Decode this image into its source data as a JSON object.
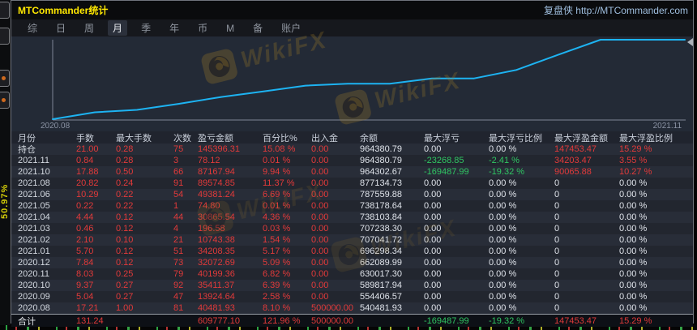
{
  "window": {
    "title": "MTCommander统计",
    "brand_link": "复盘侠 http://MTCommander.com"
  },
  "menu": {
    "items": [
      {
        "id": "zonghe",
        "label": "综",
        "active": false
      },
      {
        "id": "ri",
        "label": "日",
        "active": false
      },
      {
        "id": "zhou",
        "label": "周",
        "active": false
      },
      {
        "id": "yue",
        "label": "月",
        "active": true
      },
      {
        "id": "ji",
        "label": "季",
        "active": false
      },
      {
        "id": "nian",
        "label": "年",
        "active": false
      },
      {
        "id": "bi",
        "label": "币",
        "active": false
      },
      {
        "id": "m",
        "label": "M",
        "active": false
      },
      {
        "id": "bei",
        "label": "备",
        "active": false
      },
      {
        "id": "zhanghu",
        "label": "账户",
        "active": false
      }
    ]
  },
  "side_strip": {
    "vertical_text": "50.97%"
  },
  "chart": {
    "x_start_label": "2020.08",
    "x_end_label": "2021.11",
    "watermark_text": "WikiFX",
    "line_color": "#1db3f2"
  },
  "chart_data": {
    "type": "line",
    "title": "",
    "xlabel": "",
    "ylabel": "",
    "x_tick_labels": [
      "2020.08",
      "2021.11"
    ],
    "series": [
      {
        "name": "余额",
        "values": [
          500000,
          540481.93,
          554406.57,
          589817.94,
          630017.3,
          662089.99,
          696298.34,
          707041.72,
          707238.3,
          738103.84,
          738178.64,
          787559.88,
          877134.73,
          964302.67,
          964380.79,
          964380.79
        ]
      }
    ],
    "ylim": [
      500000,
      964380.79
    ],
    "grid": false,
    "legend": "none"
  },
  "colors": {
    "red": "#e23a3a",
    "green": "#30c663",
    "white": "#dfe3ea",
    "month": "#d5dae2",
    "header": "#c9cfda",
    "total_label": "#e8ebf0",
    "accent_line": "#1db3f2",
    "title_yellow": "#ffe800"
  },
  "table": {
    "headers": [
      "月份",
      "手数",
      "最大手数",
      "次数",
      "盈亏金额",
      "百分比%",
      "出入金",
      "余额",
      "最大浮亏",
      "最大浮亏比例",
      "最大浮盈金额",
      "最大浮盈比例"
    ],
    "rows": [
      {
        "month": "持仓",
        "values": [
          "21.00",
          "0.28",
          "75",
          "145396.31",
          "15.08 %",
          "0.00",
          "964380.79",
          "0.00",
          "0.00 %",
          "147453.47",
          "15.29 %"
        ],
        "colors": [
          "r",
          "r",
          "r",
          "r",
          "r",
          "r",
          "w",
          "w",
          "w",
          "r",
          "r"
        ]
      },
      {
        "month": "2021.11",
        "values": [
          "0.84",
          "0.28",
          "3",
          "78.12",
          "0.01 %",
          "0.00",
          "964380.79",
          "-23268.85",
          "-2.41 %",
          "34203.47",
          "3.55 %"
        ],
        "colors": [
          "r",
          "r",
          "r",
          "r",
          "r",
          "r",
          "w",
          "g",
          "g",
          "r",
          "r"
        ]
      },
      {
        "month": "2021.10",
        "values": [
          "17.88",
          "0.50",
          "66",
          "87167.94",
          "9.94 %",
          "0.00",
          "964302.67",
          "-169487.99",
          "-19.32 %",
          "90065.88",
          "10.27 %"
        ],
        "colors": [
          "r",
          "r",
          "r",
          "r",
          "r",
          "r",
          "w",
          "g",
          "g",
          "r",
          "r"
        ]
      },
      {
        "month": "2021.08",
        "values": [
          "20.82",
          "0.24",
          "91",
          "89574.85",
          "11.37 %",
          "0.00",
          "877134.73",
          "0.00",
          "0.00 %",
          "0",
          "0.00 %"
        ],
        "colors": [
          "r",
          "r",
          "r",
          "r",
          "r",
          "r",
          "w",
          "w",
          "w",
          "w",
          "w"
        ]
      },
      {
        "month": "2021.06",
        "values": [
          "10.29",
          "0.22",
          "54",
          "49381.24",
          "6.69 %",
          "0.00",
          "787559.88",
          "0.00",
          "0.00 %",
          "0",
          "0.00 %"
        ],
        "colors": [
          "r",
          "r",
          "r",
          "r",
          "r",
          "r",
          "w",
          "w",
          "w",
          "w",
          "w"
        ]
      },
      {
        "month": "2021.05",
        "values": [
          "0.22",
          "0.22",
          "1",
          "74.80",
          "0.01 %",
          "0.00",
          "738178.64",
          "0.00",
          "0.00 %",
          "0",
          "0.00 %"
        ],
        "colors": [
          "r",
          "r",
          "r",
          "r",
          "r",
          "r",
          "w",
          "w",
          "w",
          "w",
          "w"
        ]
      },
      {
        "month": "2021.04",
        "values": [
          "4.44",
          "0.12",
          "44",
          "30865.54",
          "4.36 %",
          "0.00",
          "738103.84",
          "0.00",
          "0.00 %",
          "0",
          "0.00 %"
        ],
        "colors": [
          "r",
          "r",
          "r",
          "r",
          "r",
          "r",
          "w",
          "w",
          "w",
          "w",
          "w"
        ]
      },
      {
        "month": "2021.03",
        "values": [
          "0.46",
          "0.12",
          "4",
          "196.58",
          "0.03 %",
          "0.00",
          "707238.30",
          "0.00",
          "0.00 %",
          "0",
          "0.00 %"
        ],
        "colors": [
          "r",
          "r",
          "r",
          "r",
          "r",
          "r",
          "w",
          "w",
          "w",
          "w",
          "w"
        ]
      },
      {
        "month": "2021.02",
        "values": [
          "2.10",
          "0.10",
          "21",
          "10743.38",
          "1.54 %",
          "0.00",
          "707041.72",
          "0.00",
          "0.00 %",
          "0",
          "0.00 %"
        ],
        "colors": [
          "r",
          "r",
          "r",
          "r",
          "r",
          "r",
          "w",
          "w",
          "w",
          "w",
          "w"
        ]
      },
      {
        "month": "2021.01",
        "values": [
          "5.70",
          "0.12",
          "51",
          "34208.35",
          "5.17 %",
          "0.00",
          "696298.34",
          "0.00",
          "0.00 %",
          "0",
          "0.00 %"
        ],
        "colors": [
          "r",
          "r",
          "r",
          "r",
          "r",
          "r",
          "w",
          "w",
          "w",
          "w",
          "w"
        ]
      },
      {
        "month": "2020.12",
        "values": [
          "7.84",
          "0.12",
          "73",
          "32072.69",
          "5.09 %",
          "0.00",
          "662089.99",
          "0.00",
          "0.00 %",
          "0",
          "0.00 %"
        ],
        "colors": [
          "r",
          "r",
          "r",
          "r",
          "r",
          "r",
          "w",
          "w",
          "w",
          "w",
          "w"
        ]
      },
      {
        "month": "2020.11",
        "values": [
          "8.03",
          "0.25",
          "79",
          "40199.36",
          "6.82 %",
          "0.00",
          "630017.30",
          "0.00",
          "0.00 %",
          "0",
          "0.00 %"
        ],
        "colors": [
          "r",
          "r",
          "r",
          "r",
          "r",
          "r",
          "w",
          "w",
          "w",
          "w",
          "w"
        ]
      },
      {
        "month": "2020.10",
        "values": [
          "9.37",
          "0.27",
          "92",
          "35411.37",
          "6.39 %",
          "0.00",
          "589817.94",
          "0.00",
          "0.00 %",
          "0",
          "0.00 %"
        ],
        "colors": [
          "r",
          "r",
          "r",
          "r",
          "r",
          "r",
          "w",
          "w",
          "w",
          "w",
          "w"
        ]
      },
      {
        "month": "2020.09",
        "values": [
          "5.04",
          "0.27",
          "47",
          "13924.64",
          "2.58 %",
          "0.00",
          "554406.57",
          "0.00",
          "0.00 %",
          "0",
          "0.00 %"
        ],
        "colors": [
          "r",
          "r",
          "r",
          "r",
          "r",
          "r",
          "w",
          "w",
          "w",
          "w",
          "w"
        ]
      },
      {
        "month": "2020.08",
        "values": [
          "17.21",
          "1.00",
          "81",
          "40481.93",
          "8.10 %",
          "500000.00",
          "540481.93",
          "0.00",
          "0.00 %",
          "0",
          "0.00 %"
        ],
        "colors": [
          "r",
          "r",
          "r",
          "r",
          "r",
          "r",
          "w",
          "w",
          "w",
          "w",
          "w"
        ]
      }
    ],
    "total": {
      "label": "合计",
      "values": [
        "131.24",
        "",
        "",
        "609777.10",
        "121.96 %",
        "500000.00",
        "",
        "-169487.99",
        "-19.32 %",
        "147453.47",
        "15.29 %"
      ],
      "colors": [
        "r",
        "r",
        "r",
        "r",
        "r",
        "r",
        "w",
        "g",
        "g",
        "r",
        "r"
      ]
    }
  }
}
